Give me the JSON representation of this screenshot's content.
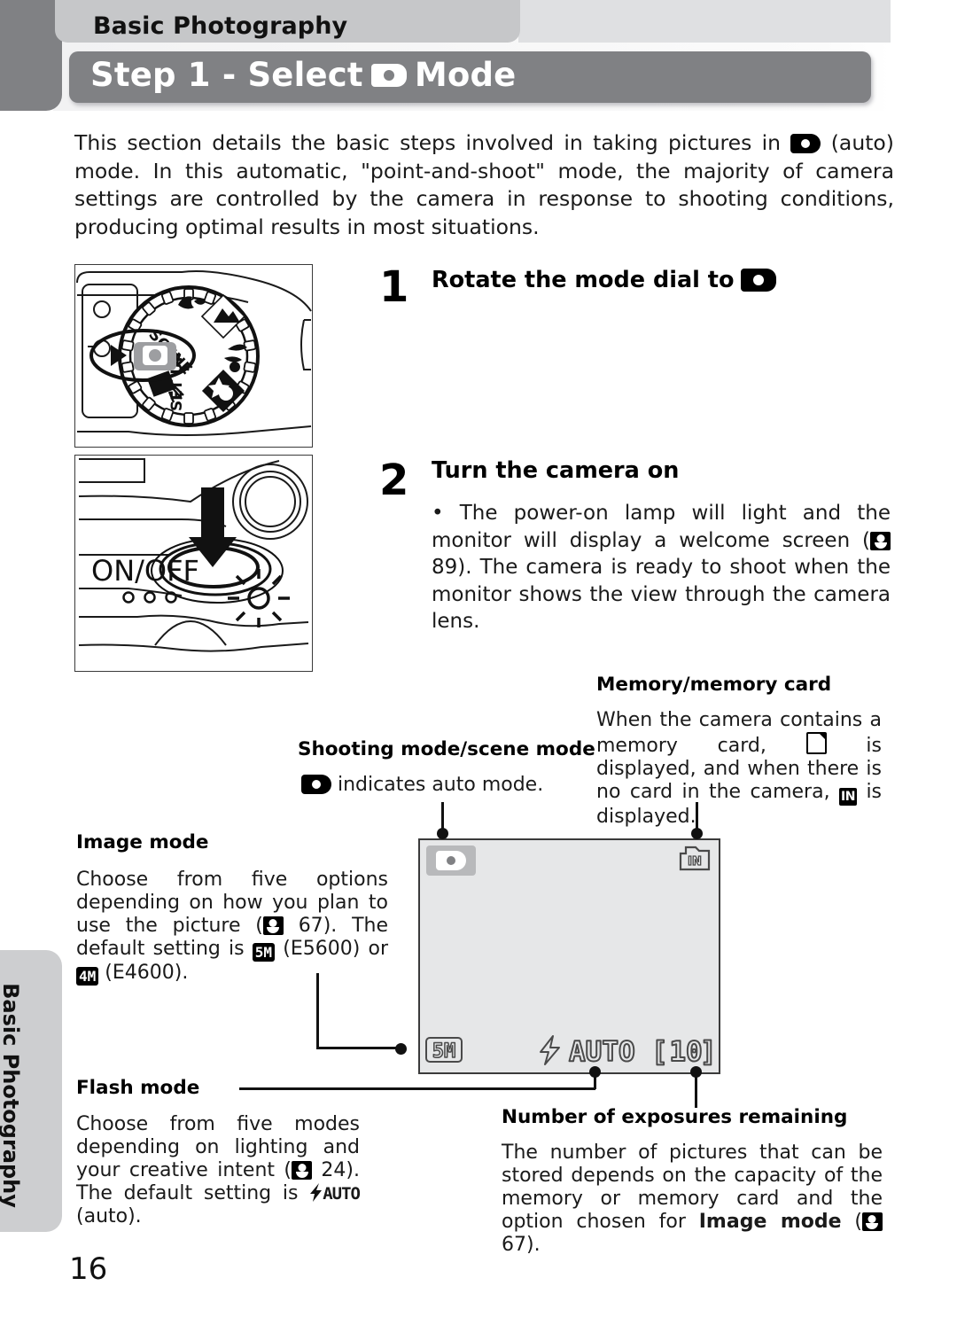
{
  "header": {
    "chapter": "Basic Photography",
    "title_prefix": "Step 1 - Select",
    "title_suffix": "Mode",
    "title_icon": "camera-auto-icon"
  },
  "intro": {
    "line1_a": "This section details the basic steps involved in taking pictures in",
    "line1_b": "(auto) mode.",
    "rest": "In this automatic, \"point-and-shoot\" mode, the majority of camera settings are controlled by the camera in response to shooting conditions, producing optimal results in most situations."
  },
  "steps": [
    {
      "number": "1",
      "heading": "Rotate the mode dial to",
      "heading_icon": "camera-auto-icon",
      "body": ""
    },
    {
      "number": "2",
      "heading": "Turn the camera on",
      "body_a": "• The power-on lamp will light and the monitor will display a welcome screen (",
      "body_ref": "89",
      "body_b": "). The camera is ready to shoot when the monitor shows the view through the camera lens."
    }
  ],
  "illustrations": {
    "mode_dial": {
      "name": "mode-dial-illustration",
      "dial_labels": [
        "SCENE",
        "SET UP"
      ]
    },
    "power_switch": {
      "name": "on-off-button-illustration",
      "label": "ON/OFF"
    }
  },
  "callouts": {
    "shooting_mode": {
      "heading": "Shooting mode/scene mode",
      "text_a": "indicates auto mode.",
      "icon": "camera-auto-icon"
    },
    "memory_card": {
      "heading": "Memory/memory card",
      "text_a": "When the camera contains a memory card,",
      "text_b": "is displayed, and when there is no card in the camera,",
      "text_c": "is displayed.",
      "icon_card": "memory-card-icon",
      "icon_internal": "internal-memory-icon"
    },
    "image_mode": {
      "heading": "Image mode",
      "text_a": "Choose from five options depending on how you plan to use the picture (",
      "ref": "67",
      "text_b": "). The default setting is",
      "badge_5m": "5M",
      "text_c": "(E5600) or",
      "badge_4m": "4M",
      "text_d": "(E4600)."
    },
    "flash_mode": {
      "heading": "Flash mode",
      "text_a": "Choose from five modes depending on lighting and your creative intent (",
      "ref": "24",
      "text_b": "). The default setting is",
      "flash_label": "AUTO",
      "text_c": "(auto)."
    },
    "exposures": {
      "heading": "Number of exposures remaining",
      "text_a": "The number of pictures that can be stored depends on the capacity of the memory or memory card and the option chosen for",
      "bold": "Image mode",
      "text_b": "(",
      "ref": "67",
      "text_c": ")."
    }
  },
  "lcd": {
    "mode_icon": "camera-auto-icon",
    "memory_icon_label": "IN",
    "image_mode_badge": "5M",
    "flash_mode_label": "AUTO",
    "exposures_remaining": "10",
    "exposures_bracket_left": "[",
    "exposures_bracket_right": "]",
    "screen_color": "#e6e7e8"
  },
  "side_tab": {
    "label": "Basic Photography"
  },
  "page_number": "16",
  "colors": {
    "header_bar": "#808184",
    "chapter_tab": "#c6c7c9",
    "side_tab": "#cdced0",
    "text": "#1a1a1a"
  }
}
